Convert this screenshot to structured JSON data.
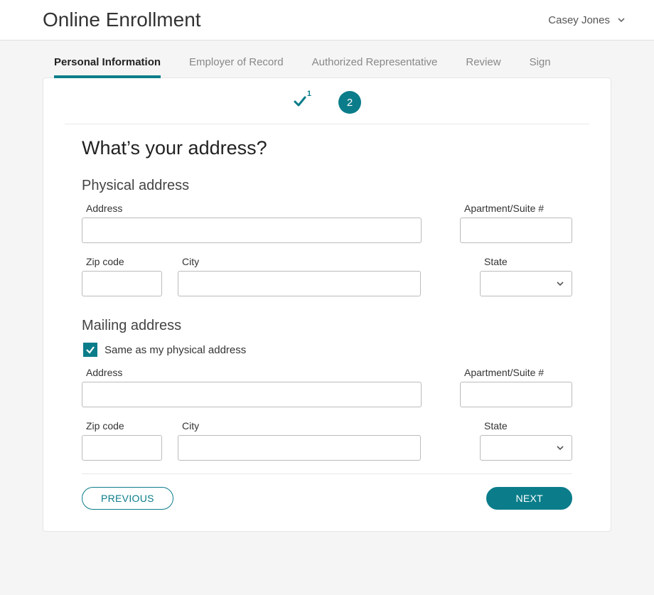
{
  "header": {
    "title": "Online Enrollment",
    "user_name": "Casey Jones"
  },
  "tabs": [
    {
      "label": "Personal Information",
      "active": true
    },
    {
      "label": "Employer of Record",
      "active": false
    },
    {
      "label": "Authorized Representative",
      "active": false
    },
    {
      "label": "Review",
      "active": false
    },
    {
      "label": "Sign",
      "active": false
    }
  ],
  "stepper": {
    "step1_number": "1",
    "step2_number": "2"
  },
  "heading": "What’s your address?",
  "physical": {
    "section_title": "Physical address",
    "address_label": "Address",
    "address_value": "",
    "apt_label": "Apartment/Suite #",
    "apt_value": "",
    "zip_label": "Zip code",
    "zip_value": "",
    "city_label": "City",
    "city_value": "",
    "state_label": "State",
    "state_value": ""
  },
  "mailing": {
    "section_title": "Mailing address",
    "same_as_label": "Same as my physical address",
    "same_as_checked": true,
    "address_label": "Address",
    "address_value": "",
    "apt_label": "Apartment/Suite #",
    "apt_value": "",
    "zip_label": "Zip code",
    "zip_value": "",
    "city_label": "City",
    "city_value": "",
    "state_label": "State",
    "state_value": ""
  },
  "buttons": {
    "previous": "PREVIOUS",
    "next": "NEXT"
  }
}
